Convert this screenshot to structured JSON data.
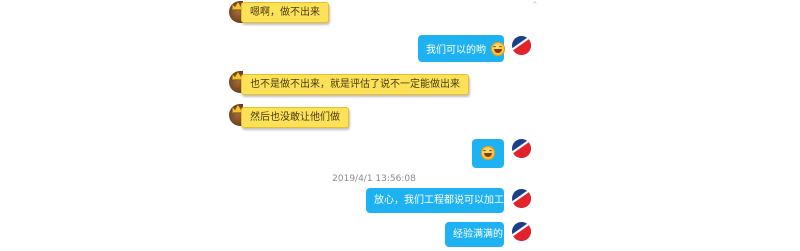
{
  "chat": {
    "collapse_icon": "chevron-up-icon",
    "timestamp": "2019/4/1 13:56:08",
    "messages": [
      {
        "side": "left",
        "text": "嗯啊，做不出来"
      },
      {
        "side": "right",
        "text": "我们可以的哟",
        "emoji": "grin-face"
      },
      {
        "side": "left",
        "text": "也不是做不出来，就是评估了说不一定能做出来"
      },
      {
        "side": "left",
        "text": "然后也没敢让他们做"
      },
      {
        "side": "right",
        "text": "",
        "emoji": "grin-face"
      },
      {
        "side": "right",
        "text": "放心，我们工程都说可以加工的"
      },
      {
        "side": "right",
        "text": "经验满满的"
      }
    ]
  },
  "colors": {
    "left_bubble": "#fde259",
    "right_bubble": "#1fb2f3"
  }
}
